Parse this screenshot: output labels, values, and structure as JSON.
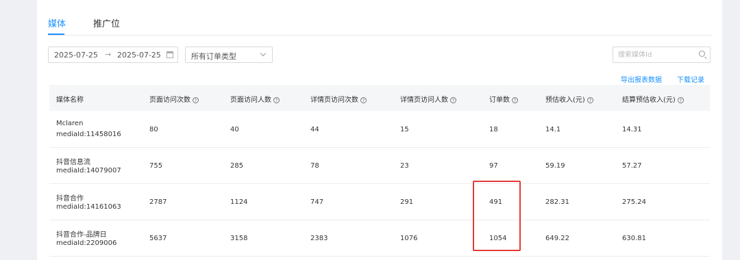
{
  "tabs": [
    {
      "label": "媒体",
      "active": true
    },
    {
      "label": "推广位",
      "active": false
    }
  ],
  "filters": {
    "date_start": "2025-07-25",
    "date_end": "2025-07-25",
    "date_separator": "→",
    "order_type": "所有订单类型",
    "search_placeholder": "搜索媒体Id"
  },
  "actions": {
    "export": "导出报表数据",
    "download_records": "下载记录"
  },
  "table": {
    "columns": [
      "媒体名称",
      "页面访问次数",
      "页面访问人数",
      "详情页访问次数",
      "详情页访问人数",
      "订单数",
      "预估收入(元)",
      "结算预估收入(元)"
    ],
    "rows": [
      {
        "name": "Mclaren",
        "media_id": "mediaId:11458016",
        "values": [
          "80",
          "40",
          "44",
          "15",
          "18",
          "14.1",
          "14.31"
        ]
      },
      {
        "name": "抖音信息流",
        "media_id": "mediaId:14079007",
        "values": [
          "755",
          "285",
          "78",
          "23",
          "97",
          "59.19",
          "57.27"
        ]
      },
      {
        "name": "抖音合作",
        "media_id": "mediaId:14161063",
        "values": [
          "2787",
          "1124",
          "747",
          "291",
          "491",
          "282.31",
          "275.24"
        ]
      },
      {
        "name": "抖音合作-品牌日",
        "media_id": "mediaId:2209006",
        "values": [
          "5637",
          "3158",
          "2383",
          "1076",
          "1054",
          "649.22",
          "630.81"
        ]
      }
    ]
  },
  "colors": {
    "accent": "#1890ff",
    "highlight_border": "#e53935",
    "header_bg": "#f5f6f8"
  }
}
